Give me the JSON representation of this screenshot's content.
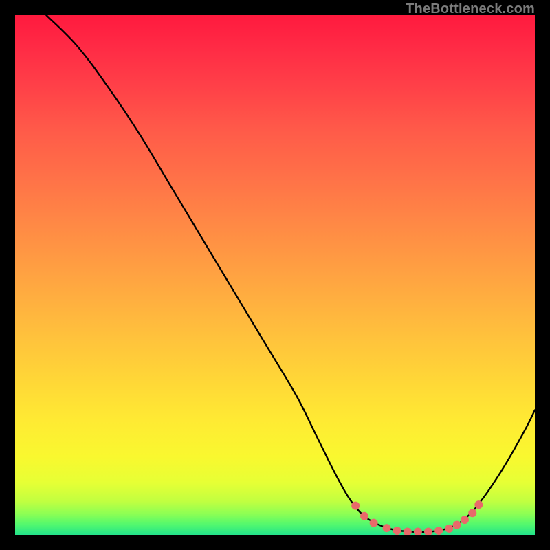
{
  "watermark": "TheBottleneck.com",
  "chart_data": {
    "type": "line",
    "title": "",
    "xlabel": "",
    "ylabel": "",
    "xlim": [
      0,
      100
    ],
    "ylim": [
      0,
      100
    ],
    "curve": [
      {
        "x": 6,
        "y": 100
      },
      {
        "x": 12,
        "y": 94
      },
      {
        "x": 18,
        "y": 86
      },
      {
        "x": 24,
        "y": 77
      },
      {
        "x": 30,
        "y": 67
      },
      {
        "x": 36,
        "y": 57
      },
      {
        "x": 42,
        "y": 47
      },
      {
        "x": 48,
        "y": 37
      },
      {
        "x": 54,
        "y": 27
      },
      {
        "x": 58,
        "y": 19
      },
      {
        "x": 62,
        "y": 11
      },
      {
        "x": 65,
        "y": 6
      },
      {
        "x": 68,
        "y": 3
      },
      {
        "x": 72,
        "y": 1.2
      },
      {
        "x": 76,
        "y": 0.6
      },
      {
        "x": 80,
        "y": 0.6
      },
      {
        "x": 84,
        "y": 1.5
      },
      {
        "x": 87,
        "y": 3.5
      },
      {
        "x": 90,
        "y": 7
      },
      {
        "x": 94,
        "y": 13
      },
      {
        "x": 98,
        "y": 20
      },
      {
        "x": 100,
        "y": 24
      }
    ],
    "markers": [
      {
        "x": 65.5,
        "y": 5.6
      },
      {
        "x": 67.2,
        "y": 3.6
      },
      {
        "x": 69.0,
        "y": 2.3
      },
      {
        "x": 71.5,
        "y": 1.3
      },
      {
        "x": 73.5,
        "y": 0.8
      },
      {
        "x": 75.5,
        "y": 0.6
      },
      {
        "x": 77.5,
        "y": 0.6
      },
      {
        "x": 79.5,
        "y": 0.6
      },
      {
        "x": 81.5,
        "y": 0.8
      },
      {
        "x": 83.5,
        "y": 1.2
      },
      {
        "x": 85.0,
        "y": 1.9
      },
      {
        "x": 86.5,
        "y": 2.9
      },
      {
        "x": 88.0,
        "y": 4.2
      },
      {
        "x": 89.2,
        "y": 5.8
      }
    ],
    "gradient_stops": [
      {
        "offset": 0.0,
        "color": "#ff1a3e"
      },
      {
        "offset": 0.06,
        "color": "#ff2a45"
      },
      {
        "offset": 0.14,
        "color": "#ff4148"
      },
      {
        "offset": 0.22,
        "color": "#ff5a49"
      },
      {
        "offset": 0.3,
        "color": "#ff6e48"
      },
      {
        "offset": 0.38,
        "color": "#ff8346"
      },
      {
        "offset": 0.46,
        "color": "#ff9843"
      },
      {
        "offset": 0.54,
        "color": "#ffad40"
      },
      {
        "offset": 0.62,
        "color": "#ffc23c"
      },
      {
        "offset": 0.7,
        "color": "#ffd637"
      },
      {
        "offset": 0.78,
        "color": "#ffea33"
      },
      {
        "offset": 0.85,
        "color": "#f9f82f"
      },
      {
        "offset": 0.9,
        "color": "#e6ff35"
      },
      {
        "offset": 0.935,
        "color": "#c2ff40"
      },
      {
        "offset": 0.96,
        "color": "#8cff54"
      },
      {
        "offset": 0.98,
        "color": "#52f86e"
      },
      {
        "offset": 1.0,
        "color": "#23e38a"
      }
    ],
    "marker_color": "#e86a6a",
    "line_color": "#000000"
  }
}
